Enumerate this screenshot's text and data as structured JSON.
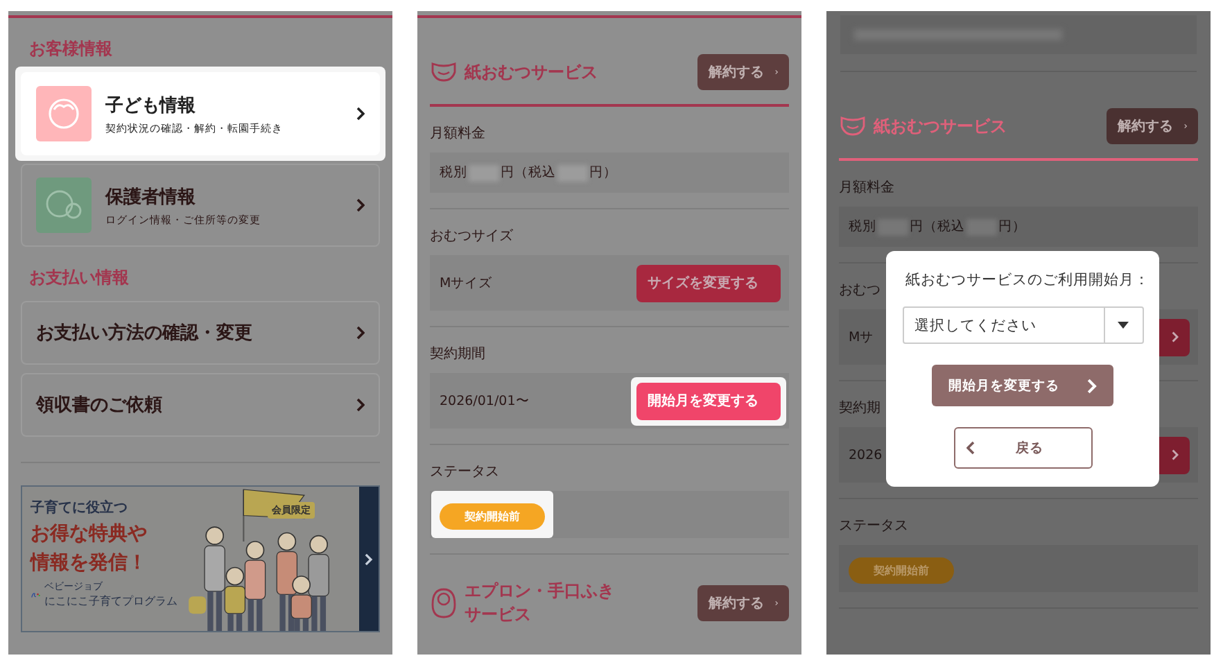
{
  "screens": [
    {
      "kind": "menu",
      "sections": [
        {
          "title": "お客様情報",
          "items": [
            {
              "kind": "profile",
              "title": "子ども情報",
              "subtitle": "契約状況の確認・解約・転園手続き",
              "highlighted": true
            },
            {
              "kind": "profile",
              "title": "保護者情報",
              "subtitle": "ログイン情報・ご住所等の変更",
              "highlighted": false
            }
          ]
        },
        {
          "title": "お支払い情報",
          "items": [
            {
              "kind": "link",
              "title": "お支払い方法の確認・変更",
              "highlighted": false
            },
            {
              "kind": "link",
              "title": "領収書のご依頼",
              "highlighted": false
            }
          ]
        }
      ],
      "banner": {
        "tagline": "子育てに役立つ",
        "headline": [
          "お得な特典や",
          "情報を発信！"
        ],
        "badge": "会員限定",
        "brand_small": "ベビージョブ",
        "brand": "にこにこ子育てプログラム"
      }
    },
    {
      "kind": "services",
      "services": [
        {
          "title": "紙おむつサービス",
          "cancel": "解約する",
          "fields": [
            {
              "kind": "price",
              "label": "月額料金",
              "parts": [
                "税別",
                "円（税込",
                "円）"
              ]
            },
            {
              "kind": "action",
              "label": "おむつサイズ",
              "value": "Mサイズ",
              "button": "サイズを変更する",
              "highlighted": false
            },
            {
              "kind": "action",
              "label": "契約期間",
              "value": "2026/01/01〜",
              "button": "開始月を変更する",
              "highlighted": true
            },
            {
              "kind": "status",
              "label": "ステータス",
              "badge": "契約開始前",
              "highlighted": true
            }
          ]
        },
        {
          "title_lines": [
            "エプロン・手口ふき",
            "サービス"
          ],
          "cancel": "解約する"
        }
      ]
    },
    {
      "kind": "services",
      "services": [
        {
          "title": "紙おむつサービス",
          "cancel": "解約する",
          "fields": [
            {
              "kind": "price",
              "label": "月額料金",
              "parts": [
                "税別",
                "円（税込",
                "円）"
              ]
            },
            {
              "kind": "action",
              "label": "おむつ",
              "value": "Mサ",
              "highlighted": false
            },
            {
              "kind": "action",
              "label": "契約期",
              "value": "2026",
              "highlighted": false
            },
            {
              "kind": "status",
              "label": "ステータス",
              "badge": "契約開始前",
              "highlighted": false
            }
          ]
        }
      ],
      "modal": {
        "title": "紙おむつサービスのご利用開始月：",
        "placeholder": "選択してください",
        "submit": "開始月を変更する",
        "back": "戻る"
      }
    }
  ]
}
